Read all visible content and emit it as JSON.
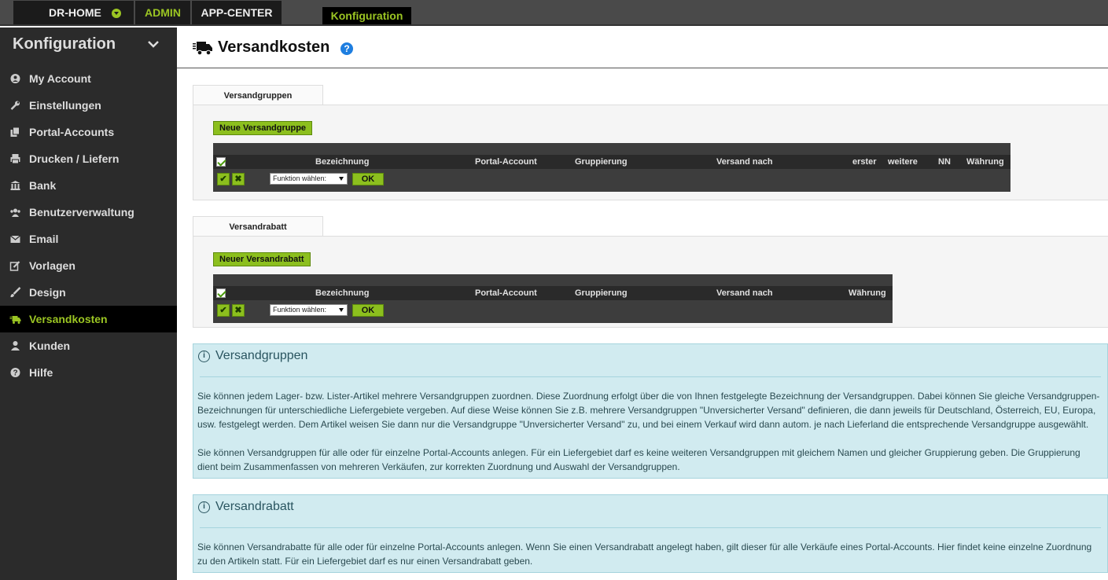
{
  "topbar": {
    "home_label": "DR-HOME",
    "admin_label": "ADMIN",
    "appcenter_label": "APP-CENTER",
    "active_section": "Konfiguration"
  },
  "sidebar": {
    "title": "Konfiguration",
    "items": [
      {
        "label": "My Account",
        "icon": "user-circle-icon"
      },
      {
        "label": "Einstellungen",
        "icon": "wrench-icon"
      },
      {
        "label": "Portal-Accounts",
        "icon": "copy-icon"
      },
      {
        "label": "Drucken / Liefern",
        "icon": "printer-icon"
      },
      {
        "label": "Bank",
        "icon": "bank-icon"
      },
      {
        "label": "Benutzerverwaltung",
        "icon": "users-icon"
      },
      {
        "label": "Email",
        "icon": "envelope-icon"
      },
      {
        "label": "Vorlagen",
        "icon": "edit-icon"
      },
      {
        "label": "Design",
        "icon": "brush-icon"
      },
      {
        "label": "Versandkosten",
        "icon": "truck-icon",
        "active": true
      },
      {
        "label": "Kunden",
        "icon": "user-icon"
      },
      {
        "label": "Hilfe",
        "icon": "question-icon"
      }
    ]
  },
  "page": {
    "title": "Versandkosten"
  },
  "versandgruppen": {
    "tab": "Versandgruppen",
    "new_button": "Neue Versandgruppe",
    "columns": [
      "Bezeichnung",
      "Portal-Account",
      "Gruppierung",
      "Versand nach",
      "erster",
      "weitere",
      "NN",
      "Währung"
    ],
    "function_select": "Funktion wählen:",
    "ok": "OK"
  },
  "versandrabatt": {
    "tab": "Versandrabatt",
    "new_button": "Neuer Versandrabatt",
    "columns": [
      "Bezeichnung",
      "Portal-Account",
      "Gruppierung",
      "Versand nach",
      "Währung"
    ],
    "function_select": "Funktion wählen:",
    "ok": "OK"
  },
  "info": [
    {
      "title": "Versandgruppen",
      "paragraphs": [
        "Sie können jedem Lager- bzw. Lister-Artikel mehrere Versandgruppen zuordnen. Diese Zuordnung erfolgt über die von Ihnen festgelegte Bezeichnung der Versandgruppen. Dabei können Sie gleiche Versandgruppen-Bezeichnungen für unterschiedliche Liefergebiete vergeben. Auf diese Weise können Sie z.B. mehrere Versandgruppen \"Unversicherter Versand\" definieren, die dann jeweils für Deutschland, Österreich, EU, Europa, usw. festgelegt werden. Dem Artikel weisen Sie dann nur die Versandgruppe \"Unversicherter Versand\" zu, und bei einem Verkauf wird dann autom. je nach Lieferland die entsprechende Versandgruppe ausgewählt.",
        "Sie können Versandgruppen für alle oder für einzelne Portal-Accounts anlegen. Für ein Liefergebiet darf es keine weiteren Versandgruppen mit gleichem Namen und gleicher Gruppierung geben. Die Gruppierung dient beim Zusammenfassen von mehreren Verkäufen, zur korrekten Zuordnung und Auswahl der Versandgruppen."
      ]
    },
    {
      "title": "Versandrabatt",
      "paragraphs": [
        "Sie können Versandrabatte für alle oder für einzelne Portal-Accounts anlegen. Wenn Sie einen Versandrabatt angelegt haben, gilt dieser für alle Verkäufe eines Portal-Accounts. Hier findet keine einzelne Zuordnung zu den Artikeln statt. Für ein Liefergebiet darf es nur einen Versandrabatt geben."
      ]
    }
  ],
  "colors": {
    "accent": "#9bc523",
    "sidebar_bg": "#2b2b2b",
    "info_bg": "#d1ebf0"
  }
}
